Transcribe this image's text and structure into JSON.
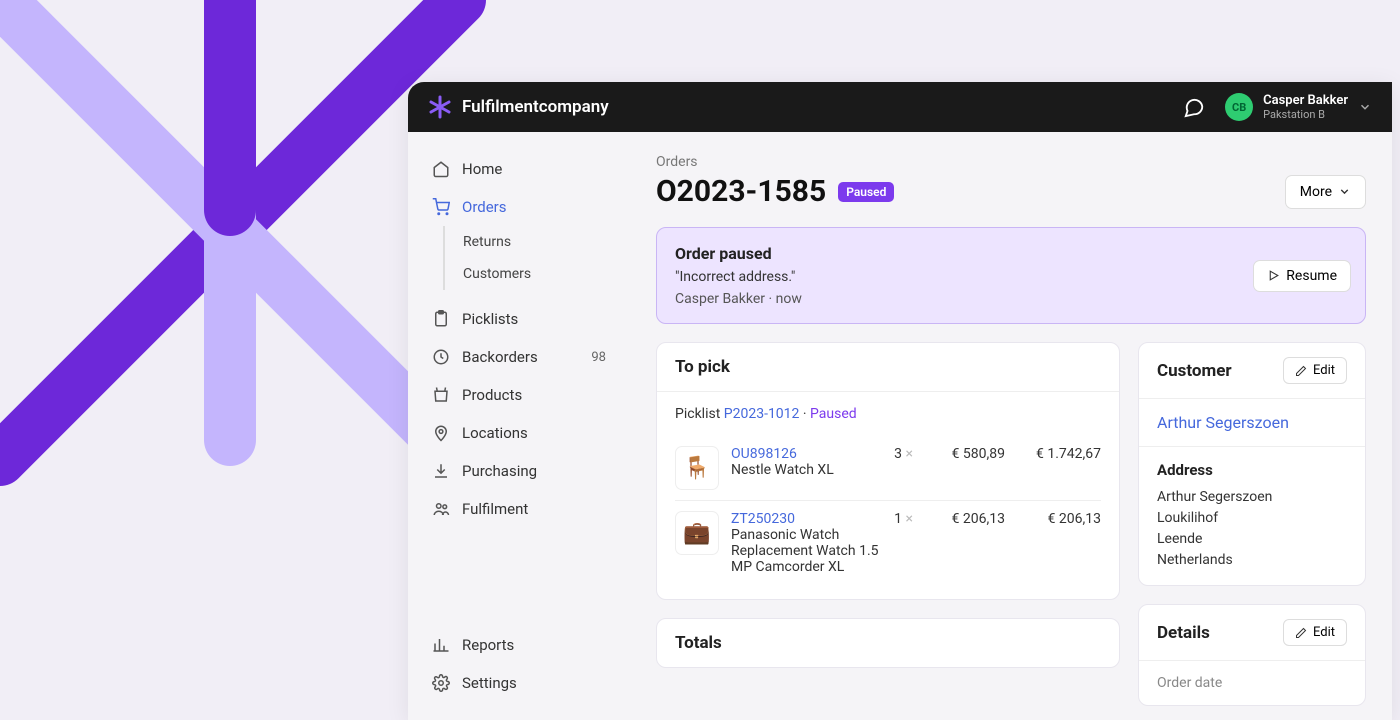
{
  "brand": "Fulfilmentcompany",
  "user": {
    "initials": "CB",
    "name": "Casper Bakker",
    "sub": "Pakstation B"
  },
  "nav": {
    "home": "Home",
    "orders": "Orders",
    "returns": "Returns",
    "customers": "Customers",
    "picklists": "Picklists",
    "backorders": "Backorders",
    "backorders_count": "98",
    "products": "Products",
    "locations": "Locations",
    "purchasing": "Purchasing",
    "fulfilment": "Fulfilment",
    "reports": "Reports",
    "settings": "Settings"
  },
  "crumb": "Orders",
  "order_id": "O2023-1585",
  "status": "Paused",
  "more_label": "More",
  "alert": {
    "title": "Order paused",
    "message": "\"Incorrect address.\"",
    "meta": "Casper Bakker · now",
    "resume": "Resume"
  },
  "to_pick": {
    "title": "To pick",
    "picklist_label": "Picklist",
    "picklist_id": "P2023-1012",
    "picklist_status": "Paused",
    "items": [
      {
        "sku": "OU898126",
        "name": "Nestle Watch XL",
        "qty": "3",
        "unit": "€ 580,89",
        "total": "€ 1.742,67",
        "emoji": "🪑"
      },
      {
        "sku": "ZT250230",
        "name": "Panasonic Watch Replacement Watch 1.5 MP Camcorder XL",
        "qty": "1",
        "unit": "€ 206,13",
        "total": "€ 206,13",
        "emoji": "💼"
      }
    ]
  },
  "totals_title": "Totals",
  "customer": {
    "title": "Customer",
    "edit": "Edit",
    "name": "Arthur Segerszoen",
    "address_title": "Address",
    "addr1": "Arthur Segerszoen",
    "addr2": "Loukilihof",
    "addr3": "Leende",
    "addr4": "Netherlands"
  },
  "details": {
    "title": "Details",
    "edit": "Edit",
    "order_date_label": "Order date"
  }
}
